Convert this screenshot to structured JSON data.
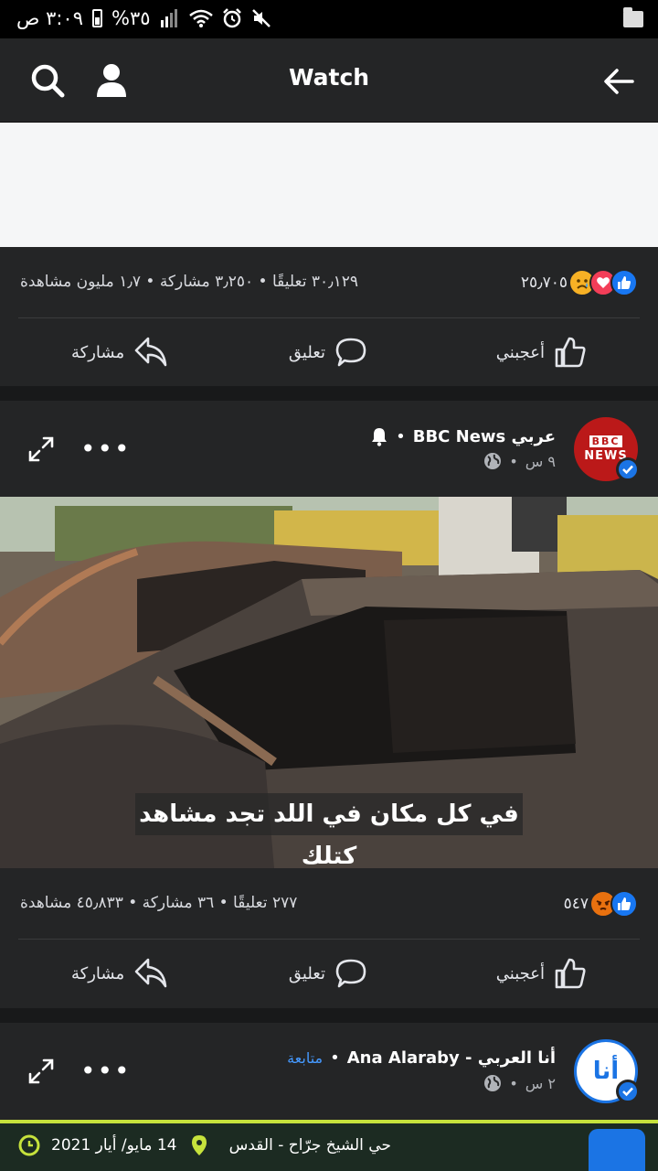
{
  "status_bar": {
    "time": "٣:٠٩ ص",
    "battery": "%٣٥"
  },
  "app_bar": {
    "title": "Watch"
  },
  "post1": {
    "reaction_count": "٢٥٫٧٠٥",
    "summary": "٣٠٫١٢٩ تعليقًا • ٣٫٢٥٠ مشاركة • ١٫٧ مليون مشاهدة",
    "actions": {
      "like": "أعجبني",
      "comment": "تعليق",
      "share": "مشاركة"
    }
  },
  "post2": {
    "page_name": "عربي BBC News",
    "time": "٩ س",
    "avatar_text": {
      "line1": "BBC",
      "line2": "NEWS"
    },
    "video_caption": "في كل مكان في اللد تجد مشاهد كتلك",
    "reaction_count": "٥٤٧",
    "summary": "٢٧٧ تعليقًا • ٣٦ مشاركة • ٤٥٫٨٣٣ مشاهدة",
    "actions": {
      "like": "أعجبني",
      "comment": "تعليق",
      "share": "مشاركة"
    }
  },
  "post3": {
    "page_name": "أنا العربي - Ana Alaraby",
    "follow": "متابعة",
    "time": "٢ س",
    "avatar_text": "أنا",
    "location": "حي الشيخ جرّاح - القدس",
    "date": "14 مايو/ أيار 2021"
  },
  "colors": {
    "accent": "#1b74e4",
    "like_blue": "#1877f2",
    "heart_red": "#f33e58",
    "angry_orange": "#e9710f",
    "bbc_red": "#bb1919",
    "highlight_green": "#c6e23c"
  }
}
